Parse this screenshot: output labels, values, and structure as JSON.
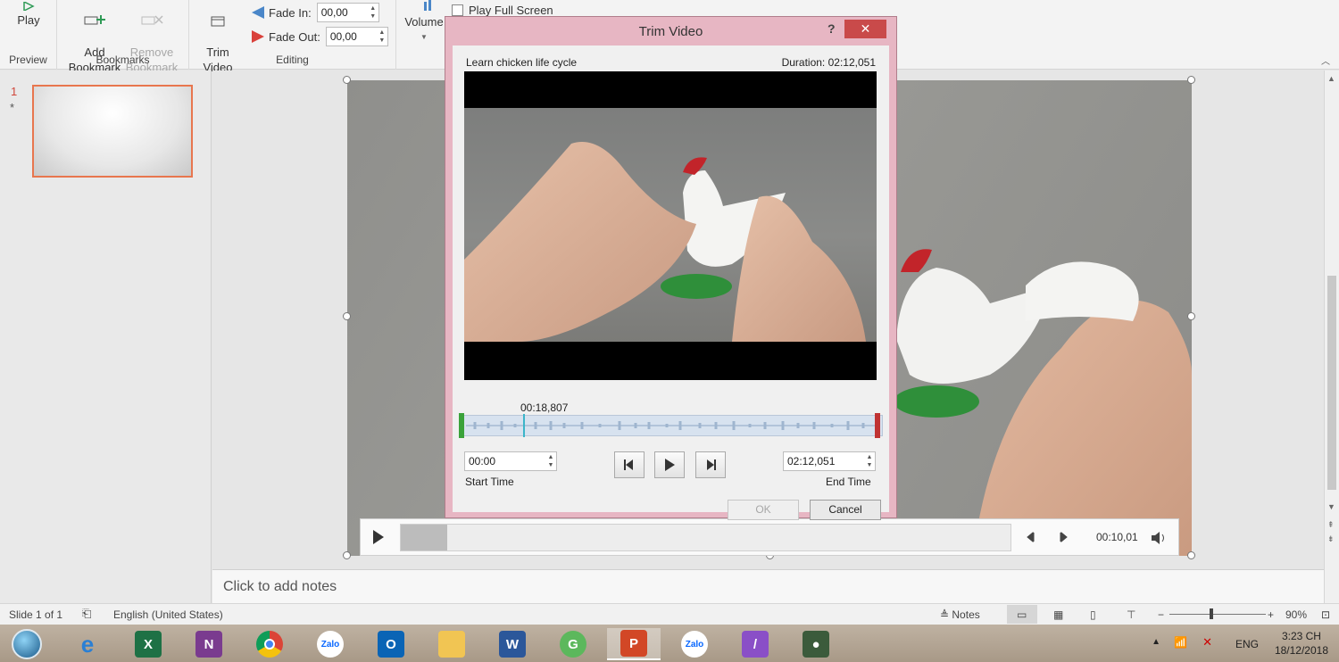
{
  "ribbon": {
    "preview": {
      "play_label": "Play",
      "group_label": "Preview"
    },
    "bookmarks": {
      "add_label": "Add\nBookmark",
      "remove_label": "Remove\nBookmark",
      "group_label": "Bookmarks"
    },
    "editing": {
      "trim_label": "Trim\nVideo",
      "fade_in_label": "Fade In:",
      "fade_in_value": "00,00",
      "fade_out_label": "Fade Out:",
      "fade_out_value": "00,00",
      "group_label": "Editing"
    },
    "volume_label": "Volume",
    "play_full_screen_label": "Play Full Screen"
  },
  "slides": {
    "number": "1",
    "star": "*"
  },
  "dialog": {
    "title": "Trim Video",
    "help": "?",
    "close": "✕",
    "video_name": "Learn chicken life cycle",
    "duration": "Duration: 02:12,051",
    "marker_time": "00:18,807",
    "start_time_value": "00:00",
    "start_time_label": "Start Time",
    "end_time_value": "02:12,051",
    "end_time_label": "End Time",
    "ok_label": "OK",
    "cancel_label": "Cancel"
  },
  "media_bar": {
    "time": "00:10,01",
    "progress_fraction": 0.076
  },
  "notes": {
    "placeholder": "Click to add notes"
  },
  "status_bar": {
    "slide_info": "Slide 1 of 1",
    "language": "English (United States)",
    "notes_label": "Notes",
    "zoom": "90%"
  },
  "taskbar": {
    "clock_time": "3:23 CH",
    "clock_date": "18/12/2018",
    "language": "ENG",
    "apps": [
      "Internet Explorer",
      "Excel",
      "OneNote",
      "Chrome",
      "Zalo",
      "Outlook",
      "File Explorer",
      "Word",
      "Greenshot",
      "PowerPoint",
      "Zalo",
      "OneNote Clipper",
      "Camtasia"
    ]
  },
  "colors": {
    "dialog_border": "#e7b6c3",
    "close_button": "#c94a4a",
    "thumb_selection": "#e8764e",
    "start_handle": "#3aa23a",
    "end_handle": "#c03333",
    "marker": "#3bb5c9"
  }
}
